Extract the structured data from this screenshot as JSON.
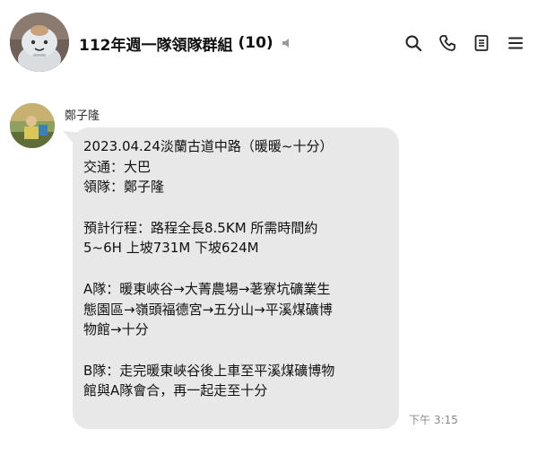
{
  "header": {
    "title": "112年週一隊領隊群組",
    "member_count": "(10)",
    "icons": [
      "speaker-muted-icon",
      "search-icon",
      "phone-icon",
      "notes-icon",
      "menu-icon"
    ]
  },
  "message": {
    "sender": "鄭子隆",
    "lines": [
      "2023.04.24淡蘭古道中路（暖暖~十分）",
      "交通：大巴",
      "領隊：鄭子隆",
      "",
      "預計行程：路程全長8.5KM 所需時間約",
      "5~6H 上坡731M 下坡624M",
      "",
      "A隊：暖東峽谷→大菁農場→荖寮坑礦業生",
      "態園區→嶺頭福德宮→五分山→平溪煤礦博",
      "物館→十分",
      "",
      "B隊：走完暖東峽谷後上車至平溪煤礦博物",
      "館與A隊會合，再一起走至十分"
    ],
    "time": "下午 3:15"
  },
  "colors": {
    "bubble": "#e8e8e8",
    "background": "#ffffff",
    "timestamp": "#888888"
  }
}
